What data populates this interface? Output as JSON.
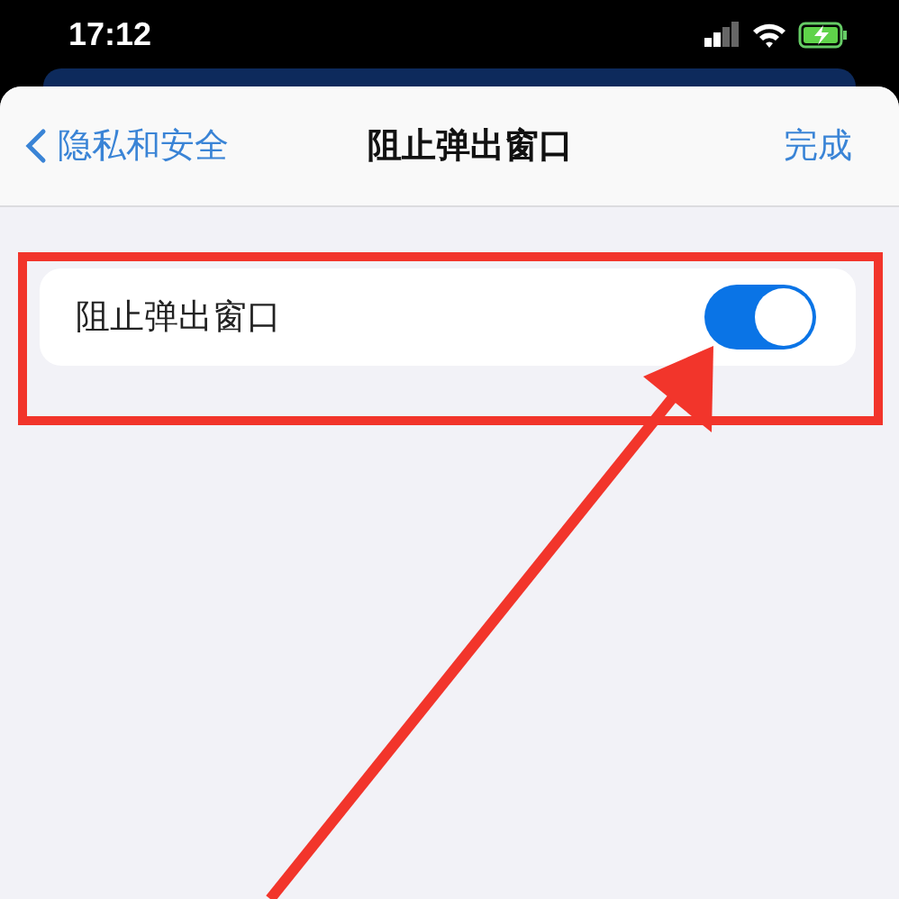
{
  "status_bar": {
    "time": "17:12"
  },
  "nav": {
    "back": "隐私和安全",
    "title": "阻止弹出窗口",
    "done": "完成"
  },
  "settings": [
    {
      "label": "阻止弹出窗口",
      "on": true
    }
  ]
}
